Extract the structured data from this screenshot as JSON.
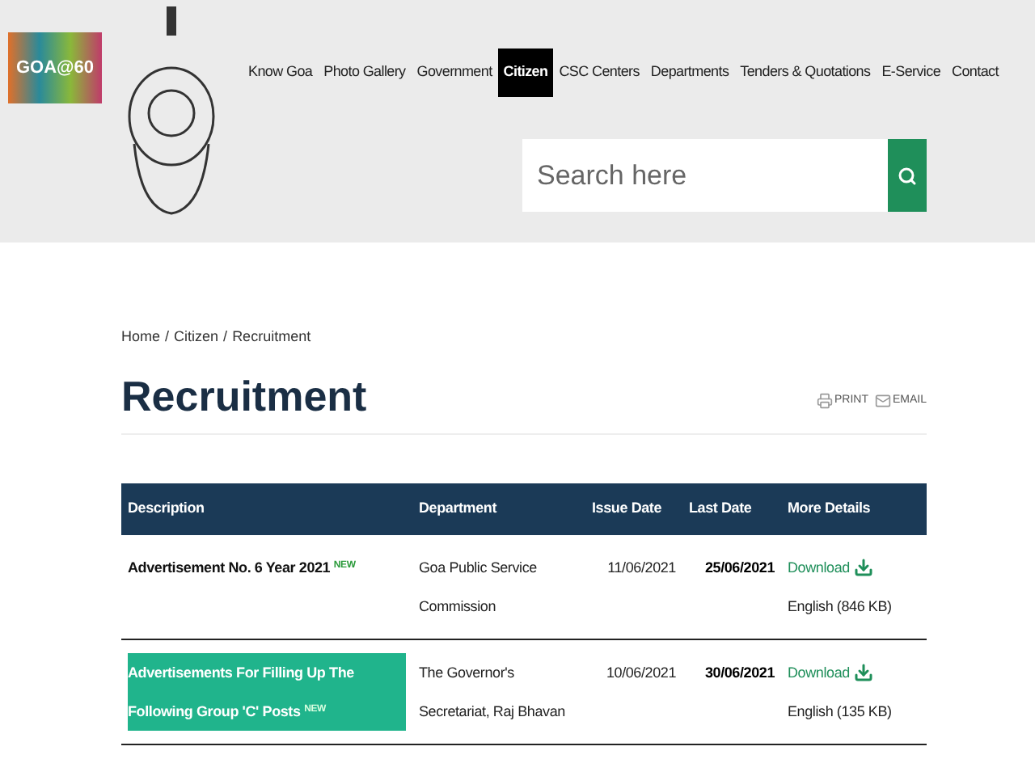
{
  "logo": {
    "text": "GOA@60"
  },
  "nav": [
    {
      "label": "Know Goa",
      "selected": false
    },
    {
      "label": "Photo Gallery",
      "selected": false
    },
    {
      "label": "Government",
      "selected": false
    },
    {
      "label": "Citizen",
      "selected": true
    },
    {
      "label": "CSC Centers",
      "selected": false
    },
    {
      "label": "Departments",
      "selected": false
    },
    {
      "label": "Tenders & Quotations",
      "selected": false
    },
    {
      "label": "E-Service",
      "selected": false
    },
    {
      "label": "Contact",
      "selected": false
    }
  ],
  "search": {
    "placeholder": "Search here"
  },
  "breadcrumb": [
    "Home",
    "Citizen",
    "Recruitment"
  ],
  "breadcrumb_separator": "/",
  "page_title": "Recruitment",
  "actions": [
    {
      "kind": "print",
      "label": "PRINT"
    },
    {
      "kind": "email",
      "label": "EMAIL"
    }
  ],
  "table": {
    "columns": [
      "Description",
      "Department",
      "Issue Date",
      "Last Date",
      "More Details"
    ],
    "rows": [
      {
        "description": "Advertisement No. 6 Year 2021",
        "badge": "NEW",
        "highlighted": false,
        "department": "Goa Public Service Commission",
        "issue_date": "11/06/2021",
        "last_date": "25/06/2021",
        "link": "Download",
        "file": "English (846 KB)"
      },
      {
        "description": "Advertisements For Filling Up The Following Group 'C' Posts",
        "badge": "NEW",
        "highlighted": true,
        "department": "The Governor's Secretariat, Raj Bhavan",
        "issue_date": "10/06/2021",
        "last_date": "30/06/2021",
        "link": "Download",
        "file": "English (135 KB)"
      }
    ]
  }
}
